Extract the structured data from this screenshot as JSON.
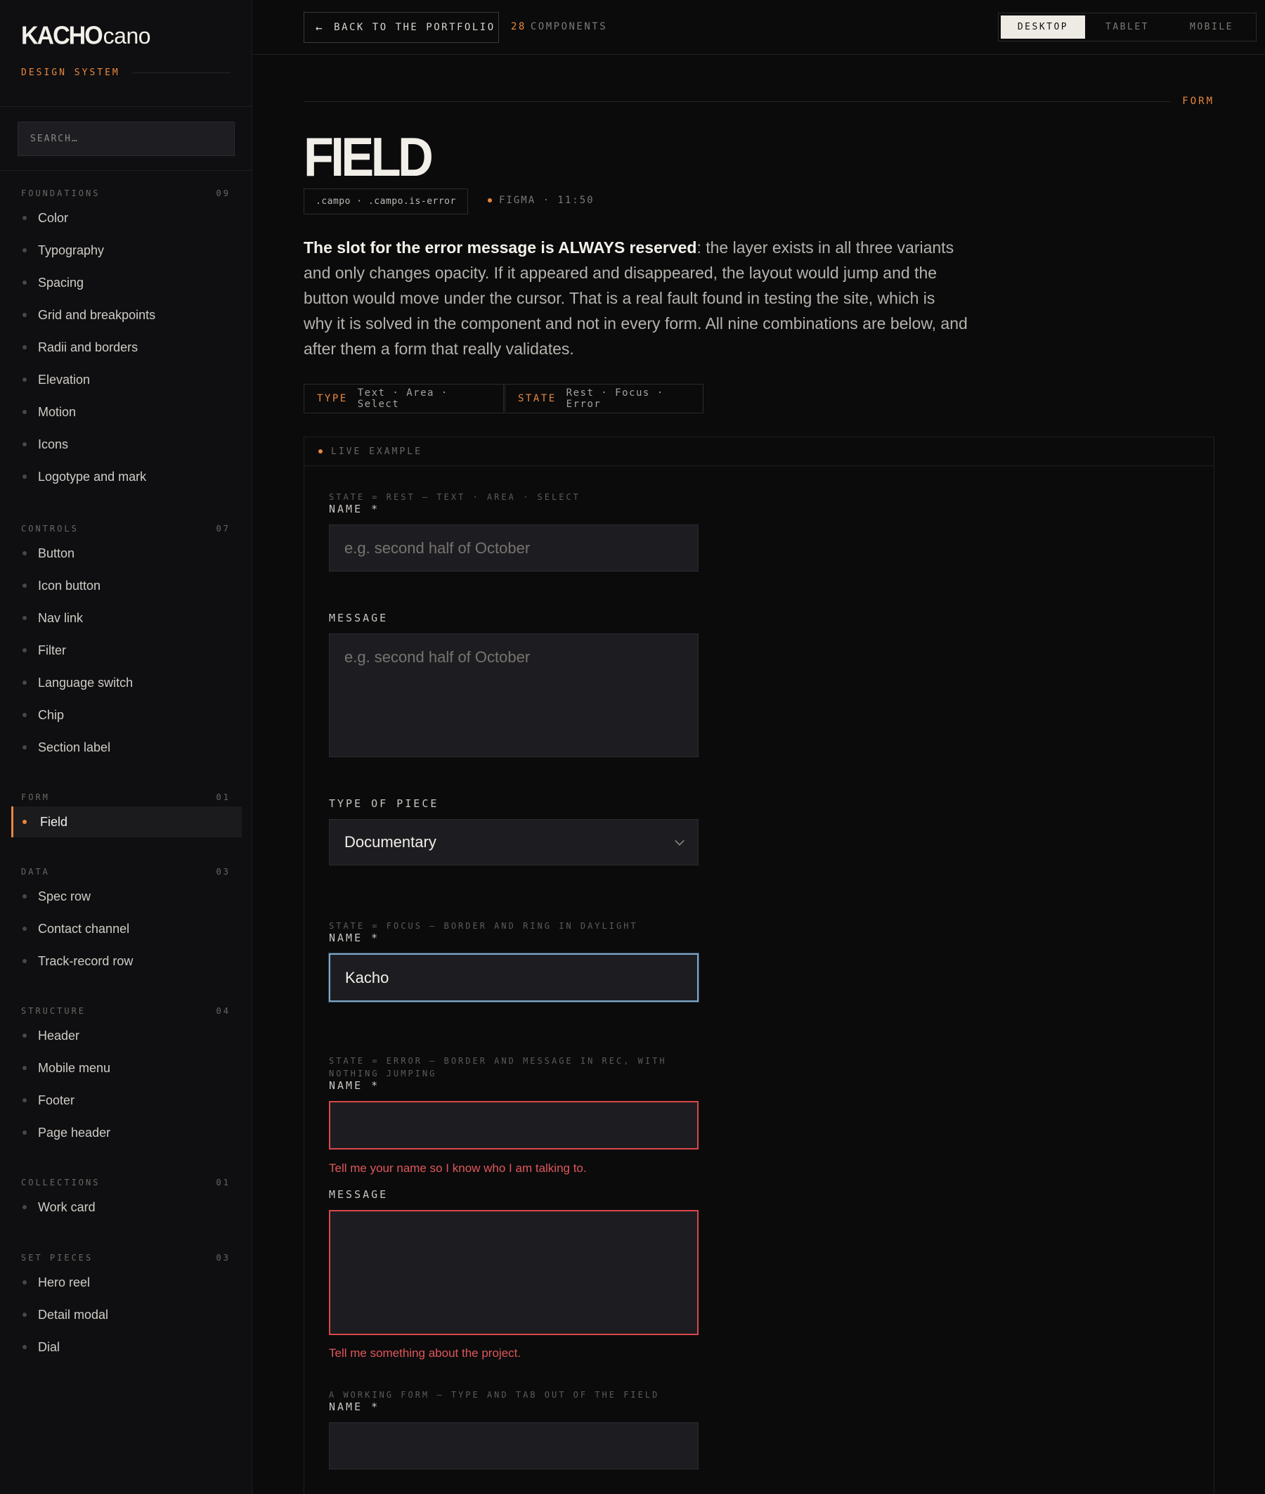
{
  "brand": {
    "mark": "KACHO",
    "word": "cano",
    "subtitle": "DESIGN SYSTEM"
  },
  "search": {
    "placeholder": "SEARCH…"
  },
  "nav": {
    "groups": [
      {
        "title": "FOUNDATIONS",
        "count": "09",
        "items": [
          "Color",
          "Typography",
          "Spacing",
          "Grid and breakpoints",
          "Radii and borders",
          "Elevation",
          "Motion",
          "Icons",
          "Logotype and mark"
        ]
      },
      {
        "title": "CONTROLS",
        "count": "07",
        "items": [
          "Button",
          "Icon button",
          "Nav link",
          "Filter",
          "Language switch",
          "Chip",
          "Section label"
        ]
      },
      {
        "title": "FORM",
        "count": "01",
        "items": [
          "Field"
        ]
      },
      {
        "title": "DATA",
        "count": "03",
        "items": [
          "Spec row",
          "Contact channel",
          "Track-record row"
        ]
      },
      {
        "title": "STRUCTURE",
        "count": "04",
        "items": [
          "Header",
          "Mobile menu",
          "Footer",
          "Page header"
        ]
      },
      {
        "title": "COLLECTIONS",
        "count": "01",
        "items": [
          "Work card"
        ]
      },
      {
        "title": "SET PIECES",
        "count": "03",
        "items": [
          "Hero reel",
          "Detail modal",
          "Dial"
        ]
      }
    ],
    "active": "Field"
  },
  "topbar": {
    "back_label": "BACK TO THE PORTFOLIO",
    "count_num": "28",
    "count_label": "COMPONENTS",
    "viewports": [
      "DESKTOP",
      "TABLET",
      "MOBILE"
    ],
    "active_viewport": "DESKTOP"
  },
  "page": {
    "eyebrow": "FORM",
    "title": "FIELD",
    "classes": ".campo · .campo.is-error",
    "figma": "FIGMA · 11:50",
    "lede_bold": "The slot for the error message is ALWAYS reserved",
    "lede_rest": ": the layer exists in all three variants and only changes opacity. If it appeared and disappeared, the layout would jump and the button would move under the cursor. That is a real fault found in testing the site, which is why it is solved in the component and not in every form. All nine combinations are below, and after them a form that really validates.",
    "type_key": "TYPE",
    "type_values": "Text · Area · Select",
    "state_key": "STATE",
    "state_values": "Rest · Focus · Error"
  },
  "example": {
    "header": "LIVE EXAMPLE",
    "rest": {
      "state": "STATE = REST — TEXT · AREA · SELECT",
      "name_label": "NAME *",
      "name_placeholder": "e.g. second half of October",
      "message_label": "MESSAGE",
      "message_placeholder": "e.g. second half of October",
      "type_label": "TYPE OF PIECE",
      "type_value": "Documentary"
    },
    "focus": {
      "state": "STATE = FOCUS — BORDER AND RING IN DAYLIGHT",
      "name_label": "NAME *",
      "name_value": "Kacho"
    },
    "error": {
      "state": "STATE = ERROR — BORDER AND MESSAGE IN REC, WITH NOTHING JUMPING",
      "name_label": "NAME *",
      "name_error": "Tell me your name so I know who I am talking to.",
      "message_label": "MESSAGE",
      "message_error": "Tell me something about the project."
    },
    "working": {
      "state": "A WORKING FORM — TYPE AND TAB OUT OF THE FIELD",
      "name_label": "NAME *"
    }
  },
  "colors": {
    "accent": "#e8873d",
    "error": "#d9474b",
    "focus": "#7ea8c9",
    "background": "#0b0b0c"
  }
}
